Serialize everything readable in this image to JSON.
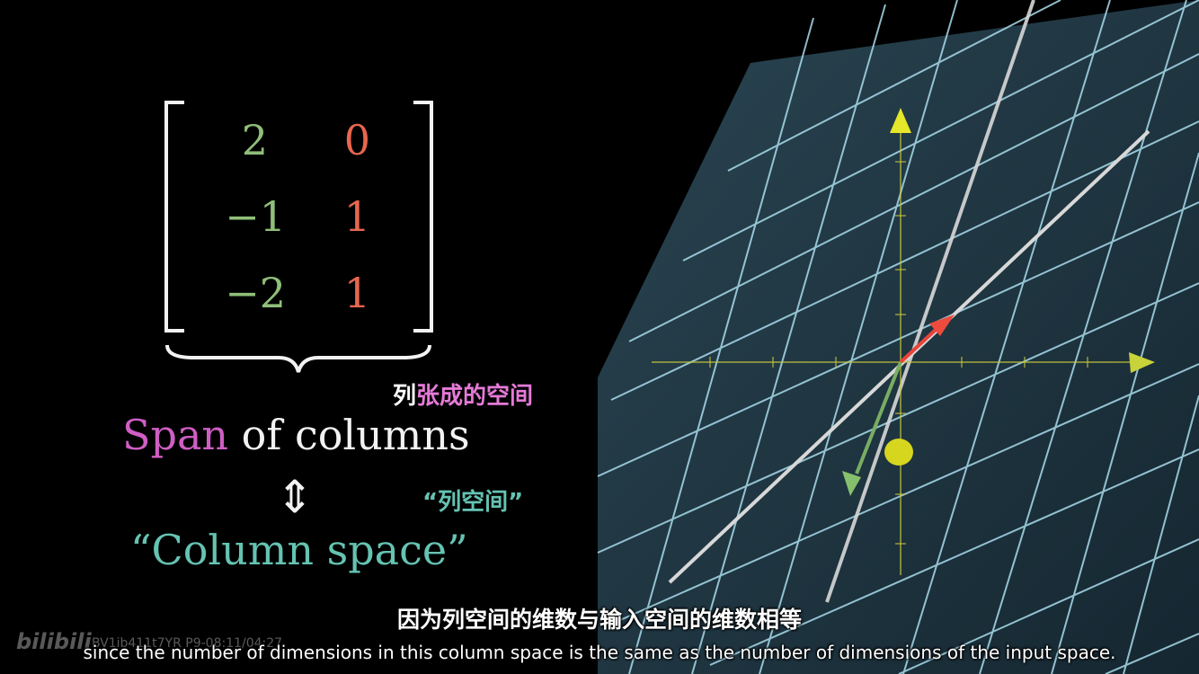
{
  "matrix": {
    "rows": [
      [
        "2",
        "0"
      ],
      [
        "−1",
        "1"
      ],
      [
        "−2",
        "1"
      ]
    ]
  },
  "labels": {
    "zh_span_prefix": "列",
    "zh_span_rest": "张成的空间",
    "span_word": "Span",
    "span_rest": " of columns",
    "iff_symbol": "⇕",
    "zh_column_space": "“列空间”",
    "column_space": "“Column space”"
  },
  "subtitles": {
    "zh": "因为列空间的维数与输入空间的维数相等",
    "en": "since the number of dimensions in this column space is the same as the number of dimensions of the input space."
  },
  "overlay": {
    "watermark": "bilibili",
    "video_id": "BV1ib411t7YR P9-08:11/04:27"
  },
  "colors": {
    "column1": "#8fbf78",
    "column2": "#e8664f",
    "span": "#cf5ec4",
    "column_space": "#65c3b2",
    "zh_span_prefix": "#ffffff",
    "zh_span_rest": "#e57ad8",
    "zh_column_space": "#65c3b2",
    "grid_plane": "#1f3440",
    "grid_lines": "#a9dcec",
    "axis": "#d4d436"
  }
}
